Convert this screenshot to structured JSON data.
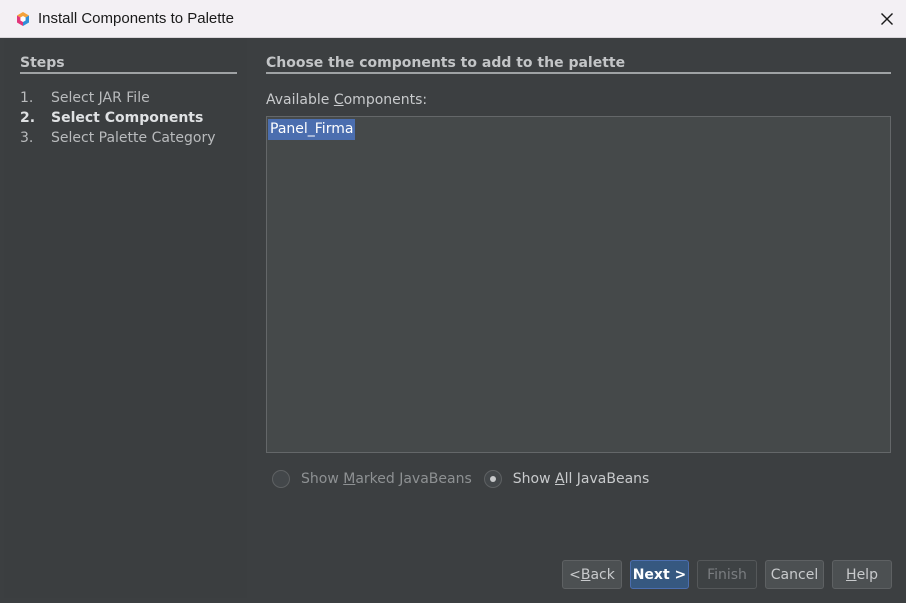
{
  "window": {
    "title": "Install Components to Palette"
  },
  "steps": {
    "heading": "Steps",
    "items": [
      {
        "number": "1.",
        "label": "Select JAR File",
        "active": false
      },
      {
        "number": "2.",
        "label": "Select Components",
        "active": true
      },
      {
        "number": "3.",
        "label": "Select Palette Category",
        "active": false
      }
    ]
  },
  "main": {
    "heading": "Choose the components to add to the palette",
    "available_label_pre": "Available ",
    "available_label_mnemonic": "C",
    "available_label_post": "omponents:",
    "components": [
      "Panel_Firma"
    ],
    "selected_component": "Panel_Firma"
  },
  "options": {
    "marked_pre": "Show ",
    "marked_mnemonic": "M",
    "marked_post": "arked JavaBeans",
    "all_pre": "Show ",
    "all_mnemonic": "A",
    "all_post": "ll JavaBeans",
    "selected": "Show All JavaBeans"
  },
  "buttons": {
    "back_pre": "< ",
    "back_mnemonic": "B",
    "back_post": "ack",
    "next": "Next >",
    "finish": "Finish",
    "cancel": "Cancel",
    "help_mnemonic": "H",
    "help_post": "elp"
  },
  "colors": {
    "dialog_bg": "#3c3f41",
    "selection": "#4b6eaf",
    "primary_button": "#365880"
  },
  "icons": {
    "app": "netbeans-cube-icon",
    "close": "close-icon"
  }
}
